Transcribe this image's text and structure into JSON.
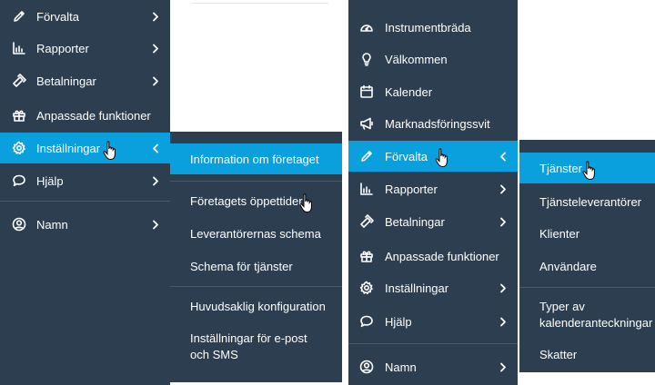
{
  "colors": {
    "sidebar_bg": "#2d3e50",
    "active_bg": "#0aa0dd",
    "divider": "#4a5a6a",
    "text": "#ffffff"
  },
  "left_sidebar": {
    "items": [
      {
        "label": "Förvalta",
        "icon": "pencil-icon",
        "chevron": "right"
      },
      {
        "label": "Rapporter",
        "icon": "bar-chart-icon",
        "chevron": "right"
      },
      {
        "label": "Betalningar",
        "icon": "payment-icon",
        "chevron": "right"
      },
      {
        "label": "Anpassade funktioner",
        "icon": "gift-icon",
        "chevron": ""
      },
      {
        "label": "Inställningar",
        "icon": "gear-icon",
        "chevron": "left",
        "active": true
      },
      {
        "label": "Hjälp",
        "icon": "chat-bubble-icon",
        "chevron": "right"
      },
      {
        "label": "Namn",
        "icon": "user-circle-icon",
        "chevron": "right"
      }
    ]
  },
  "settings_submenu": {
    "items": [
      {
        "label": "Information om företaget",
        "active": true
      },
      {
        "label": "Företagets öppettider"
      },
      {
        "label": "Leverantörernas schema"
      },
      {
        "label": "Schema för tjänster"
      },
      {
        "label": "Huvudsaklig konfiguration"
      },
      {
        "label": "Inställningar för e-post och SMS"
      }
    ]
  },
  "right_sidebar": {
    "items": [
      {
        "label": "Instrumentbräda",
        "icon": "dashboard-gauge-icon",
        "chevron": ""
      },
      {
        "label": "Välkommen",
        "icon": "lightbulb-icon",
        "chevron": ""
      },
      {
        "label": "Kalender",
        "icon": "calendar-icon",
        "chevron": ""
      },
      {
        "label": "Marknadsföringssvit",
        "icon": "megaphone-icon",
        "chevron": ""
      },
      {
        "label": "Förvalta",
        "icon": "pencil-icon",
        "chevron": "left",
        "active": true
      },
      {
        "label": "Rapporter",
        "icon": "bar-chart-icon",
        "chevron": "right"
      },
      {
        "label": "Betalningar",
        "icon": "payment-icon",
        "chevron": "right"
      },
      {
        "label": "Anpassade funktioner",
        "icon": "gift-icon",
        "chevron": ""
      },
      {
        "label": "Inställningar",
        "icon": "gear-icon",
        "chevron": "right"
      },
      {
        "label": "Hjälp",
        "icon": "chat-bubble-icon",
        "chevron": "right"
      },
      {
        "label": "Namn",
        "icon": "user-circle-icon",
        "chevron": "right"
      }
    ]
  },
  "manage_submenu": {
    "items": [
      {
        "label": "Tjänster",
        "active": true
      },
      {
        "label": "Tjänsteleverantörer"
      },
      {
        "label": "Klienter"
      },
      {
        "label": "Användare"
      },
      {
        "label": "Typer av kalenderanteckningar"
      },
      {
        "label": "Skatter"
      }
    ]
  }
}
